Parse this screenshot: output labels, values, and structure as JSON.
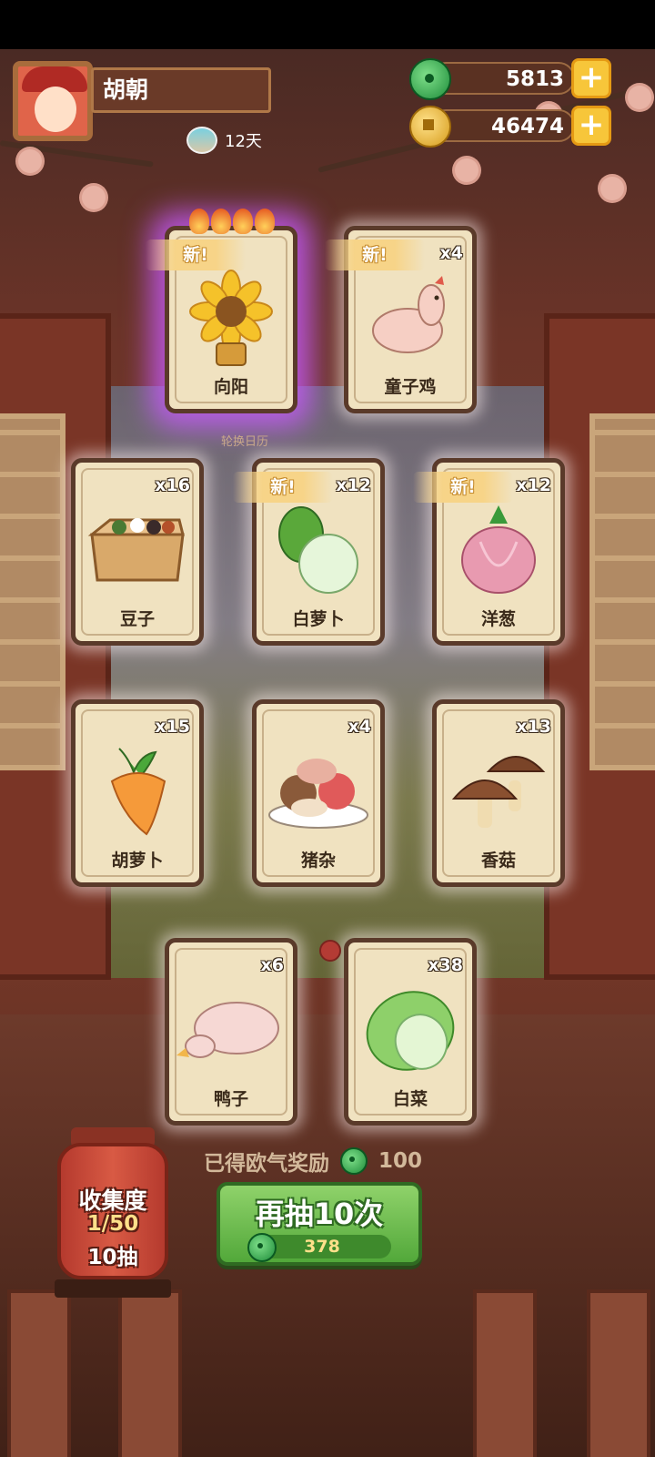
{
  "player": {
    "name": "胡朝",
    "days": "12天"
  },
  "currency": {
    "jade": "5813",
    "coins": "46474"
  },
  "center_label": "轮换日历",
  "new_label": "新",
  "cards": [
    {
      "name": "向阳",
      "count": "",
      "is_new": true
    },
    {
      "name": "童子鸡",
      "count": "x4",
      "is_new": true
    },
    {
      "name": "豆子",
      "count": "x16",
      "is_new": false
    },
    {
      "name": "白萝卜",
      "count": "x12",
      "is_new": true
    },
    {
      "name": "洋葱",
      "count": "x12",
      "is_new": true
    },
    {
      "name": "胡萝卜",
      "count": "x15",
      "is_new": false
    },
    {
      "name": "猪杂",
      "count": "x4",
      "is_new": false
    },
    {
      "name": "香菇",
      "count": "x13",
      "is_new": false
    },
    {
      "name": "鸭子",
      "count": "x6",
      "is_new": false
    },
    {
      "name": "白菜",
      "count": "x38",
      "is_new": false
    }
  ],
  "reward": {
    "label": "已得欧气奖励",
    "value": "100"
  },
  "collection": {
    "title": "收集度",
    "progress": "1/50",
    "draws": "10抽"
  },
  "draw_button": {
    "label": "再抽10次",
    "cost": "378"
  },
  "colors": {
    "accent_green": "#52a83a",
    "gold": "#f7c63a",
    "legendary_glow": "#c85aff"
  }
}
